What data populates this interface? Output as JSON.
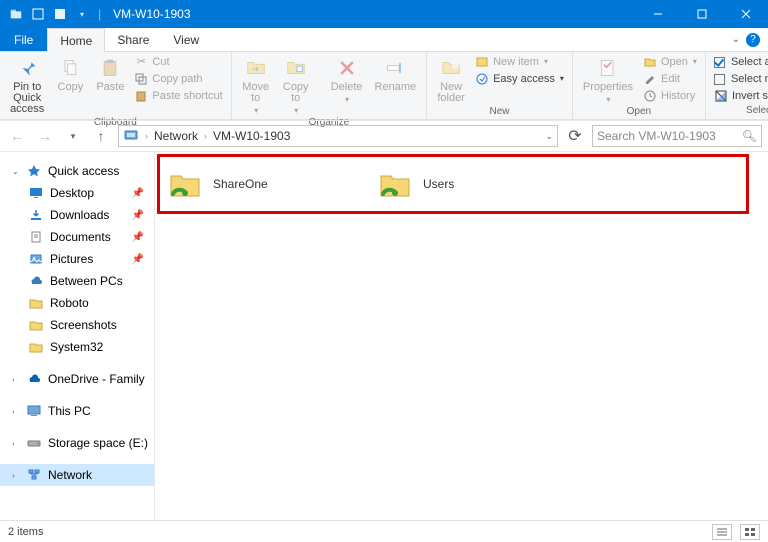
{
  "window": {
    "title": "VM-W10-1903"
  },
  "tabs": {
    "file": "File",
    "home": "Home",
    "share": "Share",
    "view": "View"
  },
  "ribbon": {
    "clipboard": {
      "label": "Clipboard",
      "pin": "Pin to Quick\naccess",
      "copy": "Copy",
      "paste": "Paste",
      "cut": "Cut",
      "copy_path": "Copy path",
      "paste_shortcut": "Paste shortcut"
    },
    "organize": {
      "label": "Organize",
      "move_to": "Move\nto",
      "copy_to": "Copy\nto",
      "delete": "Delete",
      "rename": "Rename"
    },
    "new": {
      "label": "New",
      "new_folder": "New\nfolder",
      "new_item": "New item",
      "easy_access": "Easy access"
    },
    "open": {
      "label": "Open",
      "properties": "Properties",
      "open": "Open",
      "edit": "Edit",
      "history": "History"
    },
    "select": {
      "label": "Select",
      "select_all": "Select all",
      "select_none": "Select none",
      "invert": "Invert selection"
    }
  },
  "address": {
    "crumbs": [
      "Network",
      "VM-W10-1903"
    ],
    "search_placeholder": "Search VM-W10-1903"
  },
  "sidebar": {
    "quick_access": "Quick access",
    "desktop": "Desktop",
    "downloads": "Downloads",
    "documents": "Documents",
    "pictures": "Pictures",
    "between_pcs": "Between PCs",
    "roboto": "Roboto",
    "screenshots": "Screenshots",
    "system32": "System32",
    "onedrive": "OneDrive - Family",
    "this_pc": "This PC",
    "storage": "Storage space (E:)",
    "network": "Network"
  },
  "shares": [
    {
      "name": "ShareOne"
    },
    {
      "name": "Users"
    }
  ],
  "status": {
    "items": "2 items"
  }
}
